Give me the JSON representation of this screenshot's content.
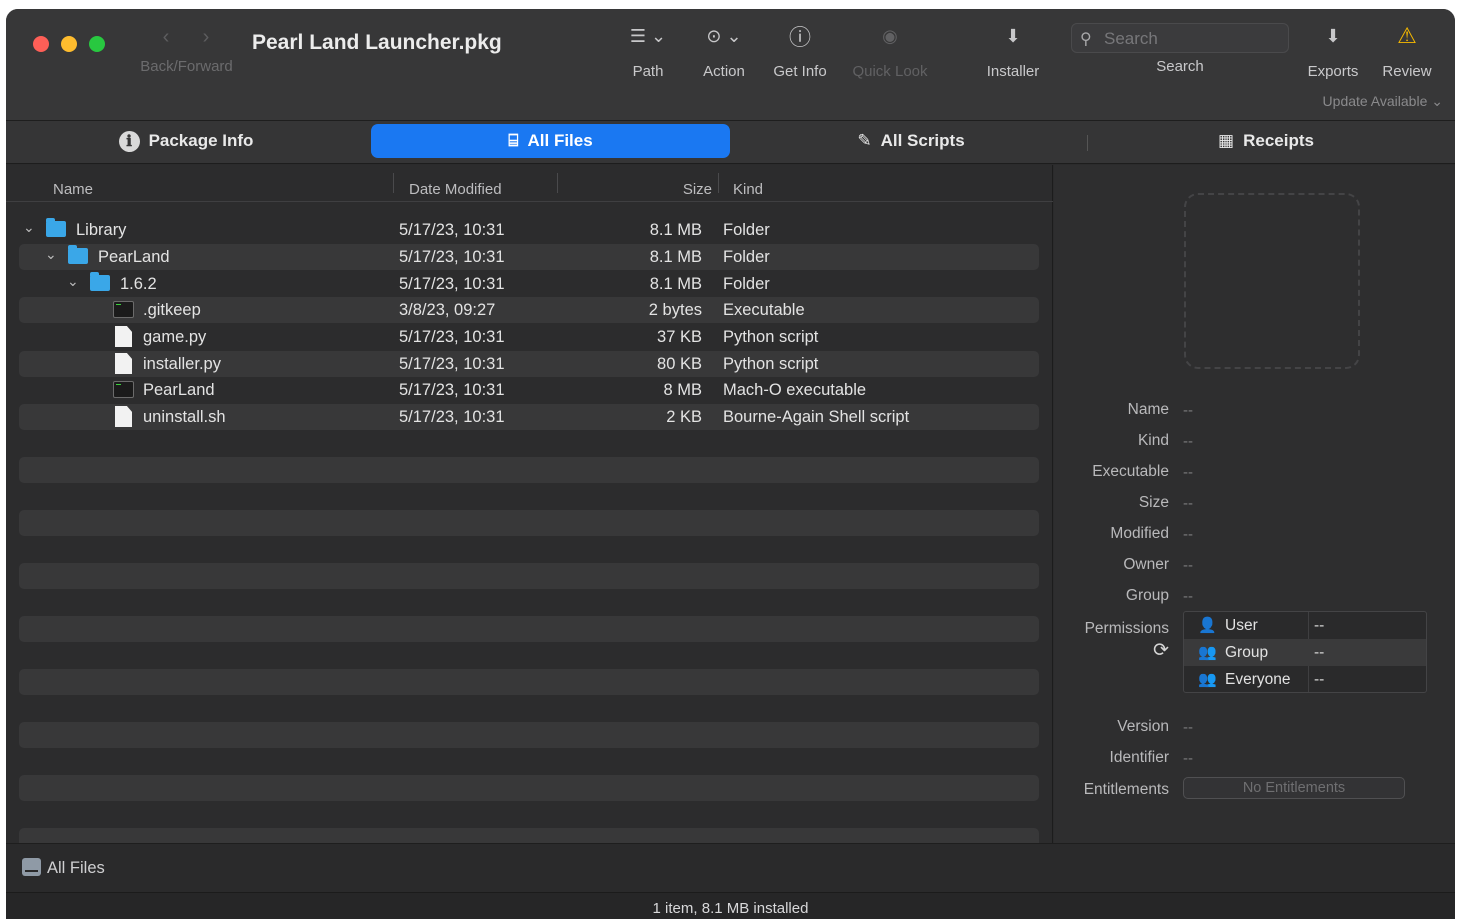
{
  "window": {
    "title": "Pearl Land Launcher.pkg",
    "nav_label": "Back/Forward",
    "nav_back_icon": "‹",
    "nav_forward_icon": "›",
    "update_link": "Update Available ⌄"
  },
  "toolbar": {
    "items": [
      {
        "label": "Path",
        "icon": "list-chevron-icon",
        "glyph": "☰ ⌄"
      },
      {
        "label": "Action",
        "icon": "ellipsis-circle-icon",
        "glyph": "⊙ ⌄"
      },
      {
        "label": "Get Info",
        "icon": "info-circle-icon",
        "glyph": "ⓘ"
      },
      {
        "label": "Quick Look",
        "icon": "eye-icon",
        "glyph": "◉"
      },
      {
        "label": "Installer",
        "icon": "install-box-icon",
        "glyph": "⬇"
      }
    ],
    "search": {
      "placeholder": "Search",
      "label": "Search",
      "icon": "🔍"
    },
    "exports": {
      "label": "Exports",
      "glyph": "⬇"
    },
    "review": {
      "label": "Review",
      "glyph": "⚠",
      "color": "#f5b800"
    }
  },
  "tabs": [
    {
      "label": "Package Info",
      "icon": "info-icon",
      "glyph": "ℹ"
    },
    {
      "label": "All Files",
      "icon": "drive-icon",
      "glyph": "⌸",
      "active": true
    },
    {
      "label": "All Scripts",
      "icon": "scroll-icon",
      "glyph": "✎"
    },
    {
      "label": "Receipts",
      "icon": "receipt-icon",
      "glyph": "▦"
    }
  ],
  "columns": {
    "name": "Name",
    "date": "Date Modified",
    "size": "Size",
    "kind": "Kind"
  },
  "files": [
    {
      "name": "Library",
      "date": "5/17/23, 10:31",
      "size": "8.1 MB",
      "kind": "Folder",
      "type": "folder",
      "level": 0
    },
    {
      "name": "PearLand",
      "date": "5/17/23, 10:31",
      "size": "8.1 MB",
      "kind": "Folder",
      "type": "folder",
      "level": 1
    },
    {
      "name": "1.6.2",
      "date": "5/17/23, 10:31",
      "size": "8.1 MB",
      "kind": "Folder",
      "type": "folder",
      "level": 2
    },
    {
      "name": ".gitkeep",
      "date": "3/8/23, 09:27",
      "size": "2 bytes",
      "kind": "Executable",
      "type": "exec",
      "level": 3
    },
    {
      "name": "game.py",
      "date": "5/17/23, 10:31",
      "size": "37 KB",
      "kind": "Python script",
      "type": "doc",
      "level": 3
    },
    {
      "name": "installer.py",
      "date": "5/17/23, 10:31",
      "size": "80 KB",
      "kind": "Python script",
      "type": "doc",
      "level": 3
    },
    {
      "name": "PearLand",
      "date": "5/17/23, 10:31",
      "size": "8 MB",
      "kind": "Mach-O executable",
      "type": "exec",
      "level": 3
    },
    {
      "name": "uninstall.sh",
      "date": "5/17/23, 10:31",
      "size": "2 KB",
      "kind": "Bourne-Again Shell script",
      "type": "doc",
      "level": 3
    }
  ],
  "inspector": {
    "placeholder": "--",
    "labels": {
      "name": "Name",
      "kind": "Kind",
      "executable": "Executable",
      "size": "Size",
      "modified": "Modified",
      "owner": "Owner",
      "group": "Group",
      "permissions": "Permissions",
      "version": "Version",
      "identifier": "Identifier",
      "entitlements": "Entitlements"
    },
    "permissions": [
      {
        "who": "User",
        "value": "--"
      },
      {
        "who": "Group",
        "value": "--"
      },
      {
        "who": "Everyone",
        "value": "--"
      }
    ],
    "entitlements_button": "No Entitlements"
  },
  "pathbar": {
    "label": "All Files"
  },
  "status": "1 item, 8.1 MB installed",
  "colors": {
    "accent": "#1a78f2",
    "folder": "#3aa7e8"
  }
}
